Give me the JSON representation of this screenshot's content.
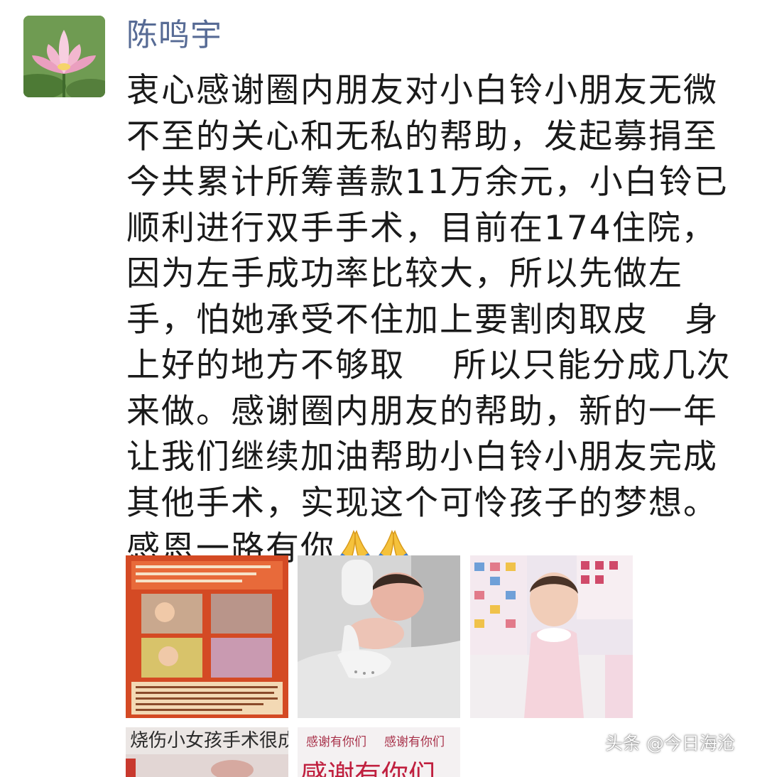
{
  "post": {
    "author": "陈鸣宇",
    "avatar_icon": "lotus-avatar-icon",
    "text_lines": [
      "衷心感谢圈内朋友对小白铃小朋友无微",
      "不至的关心和无私的帮助，发起募捐至",
      "今共累计所筹善款11万余元，小白铃已",
      "顺利进行双手手术，目前在174住院，",
      "因为左手成功率比较大，所以先做左",
      "手，怕她承受不住加上要割肉取皮   身",
      "上好的地方不够取    所以只能分成几次",
      "来做。感谢圈内朋友的帮助，新的一年",
      "让我们继续加油帮助小白铃小朋友完成",
      "其他手术，实现这个可怜孩子的梦想。",
      "感恩一路有你"
    ],
    "emoji": [
      "folded-hands-icon",
      "folded-hands-icon"
    ],
    "photos": [
      {
        "name": "photo-fundraising-poster"
      },
      {
        "name": "photo-baby-bandaged"
      },
      {
        "name": "photo-toddler-standing"
      },
      {
        "name": "photo-news-headline",
        "caption": "烧伤小女孩手术很成功"
      },
      {
        "name": "photo-thanks-card",
        "texts": [
          "感谢有你们",
          "感谢有你们",
          "感谢有你们"
        ]
      }
    ]
  },
  "watermark": "头条 @今日海沧",
  "colors": {
    "author_link": "#576b95",
    "body_text": "#1a1a1a",
    "background": "#ffffff"
  }
}
